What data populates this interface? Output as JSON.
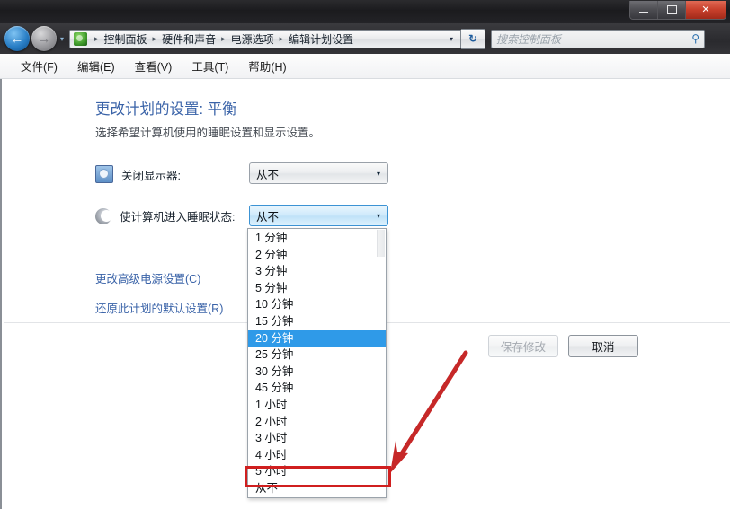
{
  "window": {
    "controls": {
      "minimize": "–",
      "maximize": "❐",
      "close": "✕"
    }
  },
  "nav": {
    "back_glyph": "←",
    "forward_glyph": "→",
    "breadcrumb_dropdown_glyph": "▾",
    "refresh_glyph": "↻",
    "address_dropdown_glyph": "▾",
    "breadcrumbs": [
      "控制面板",
      "硬件和声音",
      "电源选项",
      "编辑计划设置"
    ],
    "separator": "▸"
  },
  "search": {
    "placeholder": "搜索控制面板",
    "icon_glyph": "⚲"
  },
  "menubar": {
    "items": [
      "文件(F)",
      "编辑(E)",
      "查看(V)",
      "工具(T)",
      "帮助(H)"
    ]
  },
  "main": {
    "title": "更改计划的设置: 平衡",
    "subtitle": "选择希望计算机使用的睡眠设置和显示设置。",
    "rows": [
      {
        "label": "关闭显示器:",
        "value": "从不",
        "arrow_glyph": "▾"
      },
      {
        "label": "使计算机进入睡眠状态:",
        "value": "从不",
        "arrow_glyph": "▾"
      }
    ],
    "links": [
      "更改高级电源设置(C)",
      "还原此计划的默认设置(R)"
    ],
    "buttons": {
      "save": "保存修改",
      "cancel": "取消"
    }
  },
  "dropdown": {
    "selected_index": 6,
    "annotated_index": 14,
    "items": [
      "1 分钟",
      "2 分钟",
      "3 分钟",
      "5 分钟",
      "10 分钟",
      "15 分钟",
      "20 分钟",
      "25 分钟",
      "30 分钟",
      "45 分钟",
      "1 小时",
      "2 小时",
      "3 小时",
      "4 小时",
      "5 小时",
      "从不"
    ]
  },
  "annotation": {
    "color": "#d01f1f"
  }
}
